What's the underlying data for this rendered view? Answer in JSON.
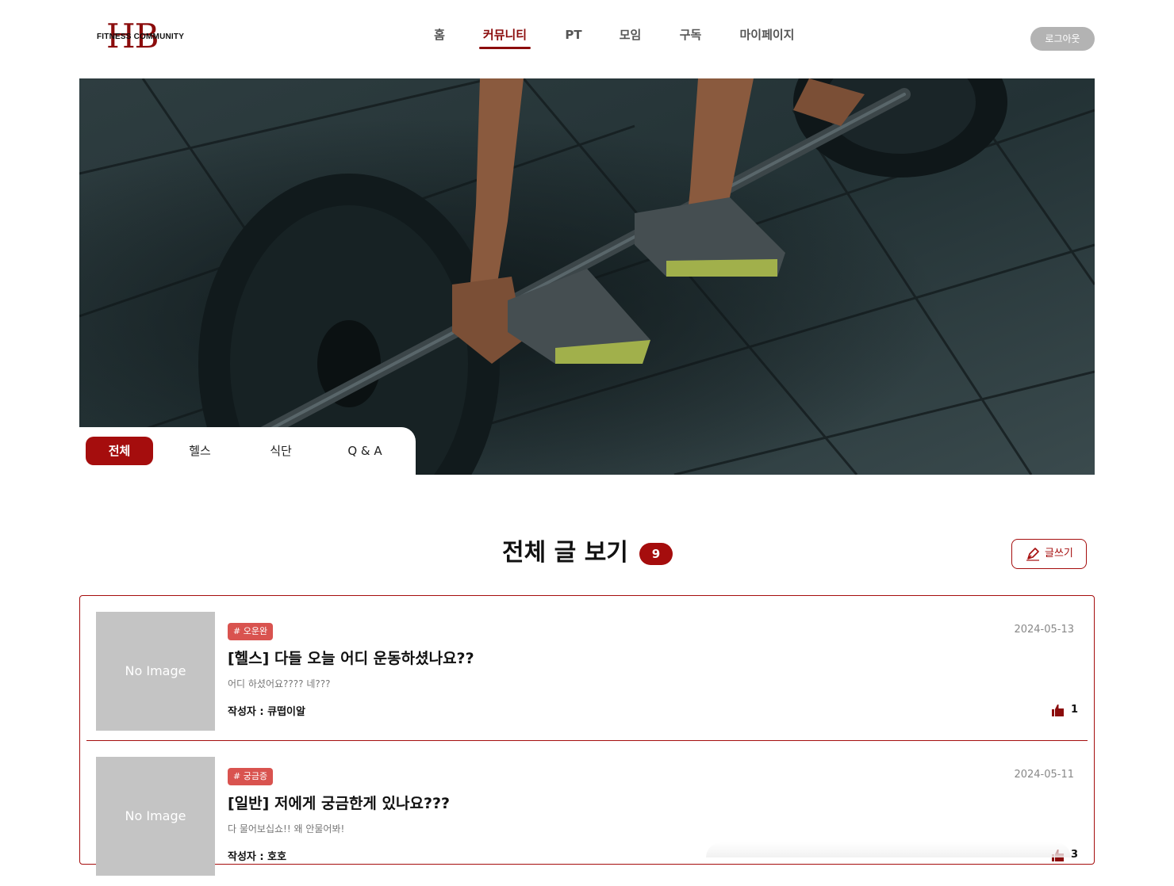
{
  "header": {
    "logo_letters": "HB",
    "logo_text": "FITNESS COMMUNITY",
    "nav": [
      {
        "label": "홈"
      },
      {
        "label": "커뮤니티"
      },
      {
        "label": "PT"
      },
      {
        "label": "모임"
      },
      {
        "label": "구독"
      },
      {
        "label": "마이페이지"
      }
    ],
    "active_nav": "커뮤니티",
    "logout_label": "로그아웃"
  },
  "categories": {
    "tabs": [
      "전체",
      "헬스",
      "식단",
      "Q & A"
    ],
    "active": "전체"
  },
  "section": {
    "title": "전체 글 보기",
    "count": "9",
    "write_label": "글쓰기"
  },
  "posts": [
    {
      "thumbnail": "No Image",
      "tag": "# 오운완",
      "title": "[헬스] 다들 오늘 어디 운동하셨나요??",
      "excerpt": "어디 하셨어요???? 네???",
      "author": "작성자 : 큐떱이알",
      "date": "2024-05-13",
      "likes": "1"
    },
    {
      "thumbnail": "No Image",
      "tag": "# 궁금증",
      "title": "[일반] 저에게 궁금한게 있나요???",
      "excerpt": "다 물어보십쇼!! 왜 안물어봐!",
      "author": "작성자 : 호호",
      "date": "2024-05-11",
      "likes": "3"
    }
  ],
  "colors": {
    "brand": "#a50d0d",
    "tag": "#d9534f",
    "thumbnail_placeholder": "#c4c4c4",
    "logout_bg": "#b3b3b3"
  }
}
